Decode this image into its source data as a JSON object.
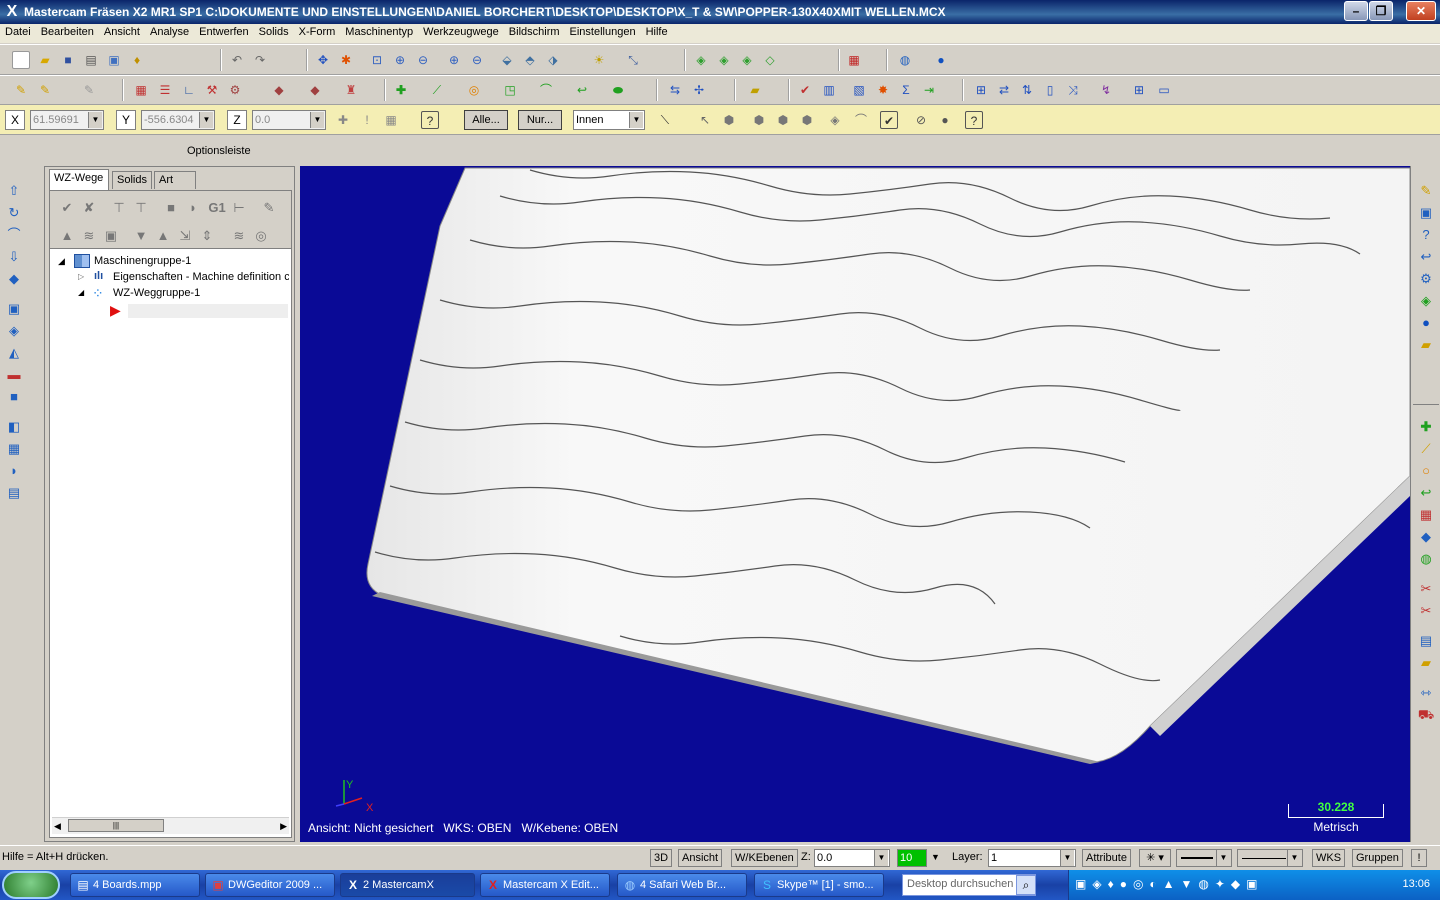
{
  "window": {
    "title": "Mastercam Fräsen X2 MR1 SP1  C:\\DOKUMENTE UND EINSTELLUNGEN\\DANIEL BORCHERT\\DESKTOP\\DESKTOP\\X_T & SW\\POPPER-130X40XMIT WELLEN.MCX"
  },
  "menu": [
    "Datei",
    "Bearbeiten",
    "Ansicht",
    "Analyse",
    "Entwerfen",
    "Solids",
    "X-Form",
    "Maschinentyp",
    "Werkzeugwege",
    "Bildschirm",
    "Einstellungen",
    "Hilfe"
  ],
  "optionbar": {
    "x_label": "X",
    "x_value": "61.59691",
    "y_label": "Y",
    "y_value": "-556.6304",
    "z_label": "Z",
    "z_value": "0.0",
    "alle_label": "Alle...",
    "nur_label": "Nur...",
    "mode_value": "Innen",
    "caption": "Optionsleiste"
  },
  "manager": {
    "tabs": [
      "WZ-Wege",
      "Solids",
      "Art"
    ],
    "tree": {
      "root": "Maschinengruppe-1",
      "properties": "Eigenschaften - Machine definition ci",
      "group": "WZ-Weggruppe-1"
    },
    "g1_label": "G1"
  },
  "viewport": {
    "view_label": "Ansicht:",
    "view_value": "Nicht gesichert",
    "wks_label": "WKS: OBEN",
    "wplane_label": "W/Kebene: OBEN",
    "scale_value": "30.228",
    "scale_unit": "Metrisch",
    "axis_y": "Y",
    "axis_x": "X"
  },
  "statusbar": {
    "help_text": "Hilfe = Alt+H drücken.",
    "btn_3d": "3D",
    "btn_ansicht": "Ansicht",
    "btn_wkebenen": "W/KEbenen",
    "z_label": "Z:",
    "z_value": "0.0",
    "color_value": "10",
    "layer_label": "Layer:",
    "layer_value": "1",
    "btn_attribute": "Attribute",
    "btn_wks": "WKS",
    "btn_gruppen": "Gruppen",
    "btn_excl": "!"
  },
  "taskbar": {
    "tasks": [
      {
        "label": "4 Boards.mpp"
      },
      {
        "label": "DWGeditor 2009 ..."
      },
      {
        "label": "2 MastercamX"
      },
      {
        "label": "Mastercam X Edit..."
      },
      {
        "label": "4 Safari Web Br..."
      },
      {
        "label": "Skype™ [1] - smo..."
      }
    ],
    "search_placeholder": "Desktop durchsuchen",
    "clock": "13:06"
  },
  "colors": {
    "viewport_bg": "#0a0a96",
    "title_bg": "#0a246a",
    "option_bg": "#f4eeb4",
    "scale_value_color": "#40ff40"
  }
}
